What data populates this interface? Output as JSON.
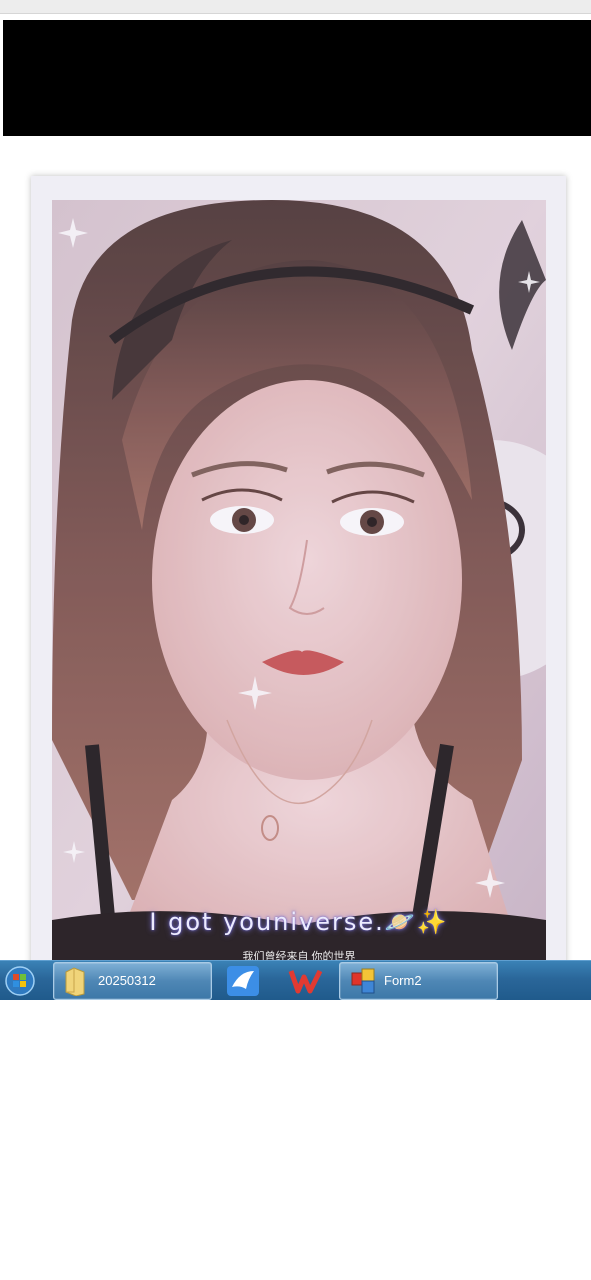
{
  "header": {
    "cut_text": ""
  },
  "photo": {
    "caption": "I got youniverse.🪐✨",
    "subcaption": "我们曾经来自 你的世界"
  },
  "taskbar": {
    "items": [
      {
        "label": "20250312",
        "icon": "folder-icon"
      },
      {
        "label": "",
        "icon": "feishu-app-icon"
      },
      {
        "label": "",
        "icon": "wps-office-icon"
      },
      {
        "label": "Form2",
        "icon": "form-window-icon"
      }
    ],
    "start_icon": "windows-start-icon"
  },
  "colors": {
    "taskbar": "#2a6699",
    "header": "#000000",
    "card": "#efeef5"
  }
}
